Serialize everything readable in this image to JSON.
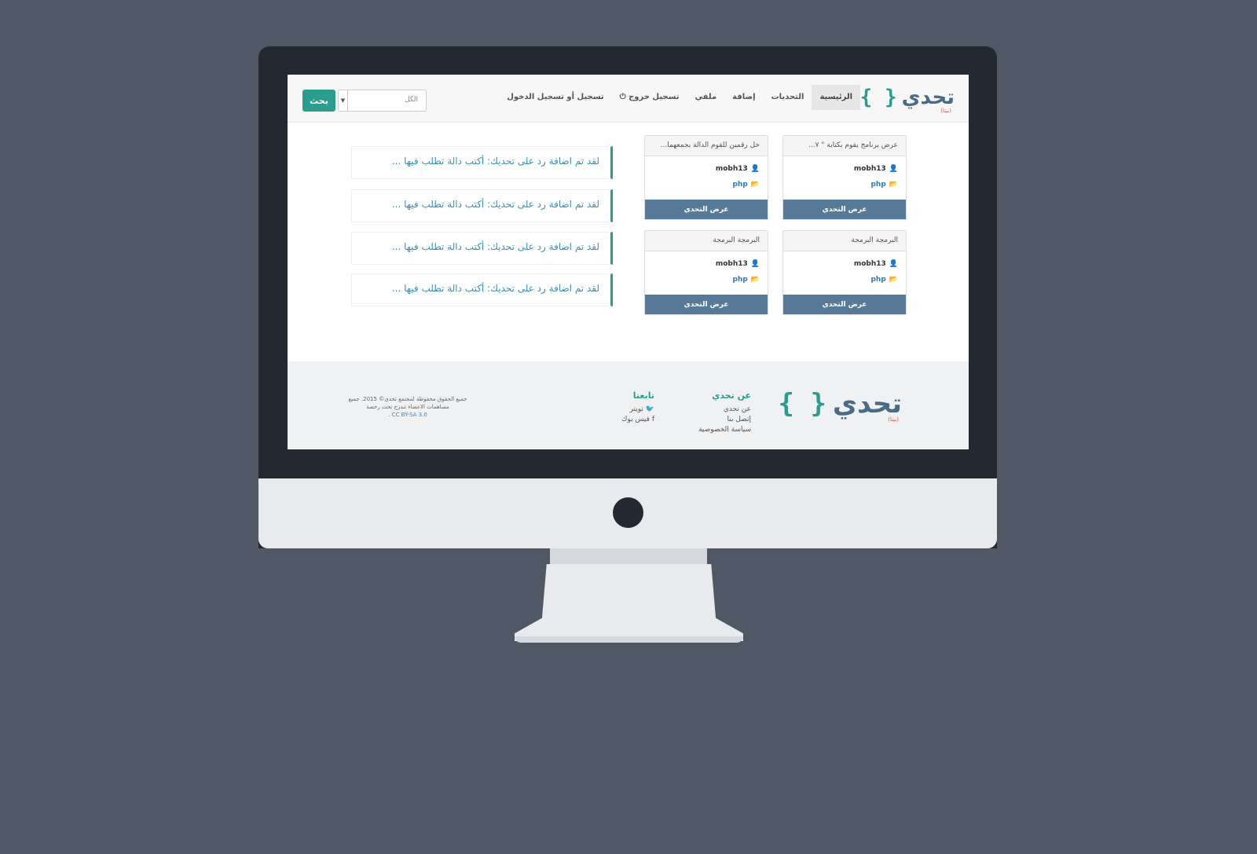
{
  "navbar": {
    "logo_word": "تحدي",
    "logo_braces": "{ }",
    "logo_beta": "(بيتا)",
    "items": [
      {
        "label": "الرئيسية",
        "active": true
      },
      {
        "label": "التحديات"
      },
      {
        "label": "إضافة"
      },
      {
        "label": "ملفي"
      },
      {
        "label": "تسجيل خروج ⏻"
      },
      {
        "label": "تسجيل أو تسجيل الدخول"
      }
    ],
    "search": {
      "select_value": "الكل",
      "button_label": "بحث"
    }
  },
  "cards": [
    {
      "title": "عرض برنامج يقوم بكتابة \" ٧...",
      "user": "mobh13",
      "lang": "php",
      "button": "عرض التحدي"
    },
    {
      "title": "خل رقمين للقوم الدالة بجمعهما...",
      "user": "mobh13",
      "lang": "php",
      "button": "عرض التحدي"
    },
    {
      "title": "البرمجة البرمجة",
      "user": "mobh13",
      "lang": "php",
      "button": "عرض التحدي"
    },
    {
      "title": "البرمجة البرمجة",
      "user": "mobh13",
      "lang": "php",
      "button": "عرض التحدي"
    }
  ],
  "notifications": [
    "لقد تم اضافة رد على تحديك: أكتب دالة تطلب فيها ...",
    "لقد تم اضافة رد على تحديك: أكتب دالة تطلب فيها ...",
    "لقد تم اضافة رد على تحديك: أكتب دالة تطلب فيها ...",
    "لقد تم اضافة رد على تحديك: أكتب دالة تطلب فيها ..."
  ],
  "footer": {
    "about": {
      "heading": "عن تحدي",
      "links": [
        "عن تحدي",
        "إتصل بنا",
        "سياسة الخصوصية"
      ]
    },
    "follow": {
      "heading": "تابعنا",
      "links": [
        "تويتر",
        "فيس بوك"
      ]
    },
    "copyright_line1": "جميع الحقوق محفوظة لمجتمع تحدي© 2015. جميع",
    "copyright_line2": "مساهمات الاعضاء تندرج تحت رخصة",
    "license": "CC BY-SA 3.0 ."
  },
  "colors": {
    "accent": "#2a9d8f",
    "card_button": "#587a99",
    "background": "#505866",
    "bezel": "#242830"
  }
}
